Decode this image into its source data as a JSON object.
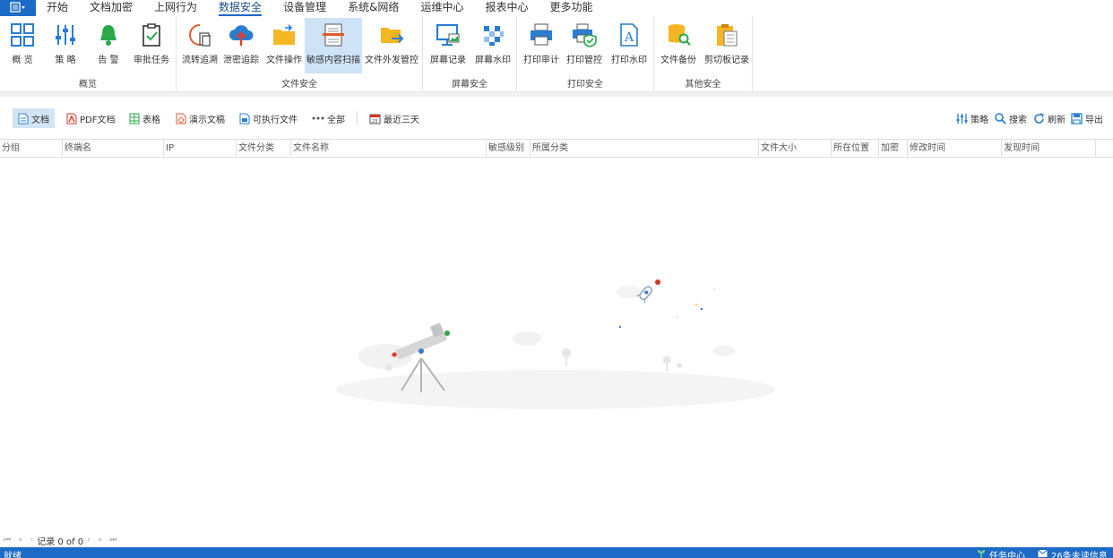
{
  "menu": {
    "app_icon": "menu-icon",
    "items": [
      "开始",
      "文档加密",
      "上网行为",
      "数据安全",
      "设备管理",
      "系统&网络",
      "运维中心",
      "报表中心",
      "更多功能"
    ],
    "active": "数据安全"
  },
  "ribbon": {
    "groups": [
      {
        "label": "概览",
        "buttons": [
          "概 览",
          "策 略",
          "告 警",
          "审批任务"
        ]
      },
      {
        "label": "文件安全",
        "buttons": [
          "流转追溯",
          "泄密追踪",
          "文件操作",
          "敏感内容扫描",
          "文件外发管控"
        ]
      },
      {
        "label": "屏幕安全",
        "buttons": [
          "屏幕记录",
          "屏幕水印"
        ]
      },
      {
        "label": "打印安全",
        "buttons": [
          "打印审计",
          "打印管控",
          "打印水印"
        ]
      },
      {
        "label": "其他安全",
        "buttons": [
          "文件备份",
          "剪切板记录"
        ]
      }
    ],
    "selected": "敏感内容扫描"
  },
  "filters": {
    "types": [
      "文档",
      "PDF文档",
      "表格",
      "演示文稿",
      "可执行文件",
      "全部"
    ],
    "active": "文档",
    "date_range": "最近三天",
    "actions": [
      "策略",
      "搜索",
      "刷新",
      "导出"
    ]
  },
  "table": {
    "columns": [
      "分组",
      "终端名",
      "IP",
      "文件分类",
      "文件名称",
      "敏感级别",
      "所属分类",
      "文件大小",
      "所在位置",
      "加密",
      "修改时间",
      "发现时间"
    ]
  },
  "pager": {
    "record_text": "记录 0 of 0"
  },
  "status": {
    "left": "就绪",
    "task_center": "任务中心",
    "unread": "26条未读信息"
  },
  "colors": {
    "accent": "#1c6bc6",
    "selected_bg": "#cfe3f7",
    "filter_active_bg": "#d3e4f5"
  }
}
